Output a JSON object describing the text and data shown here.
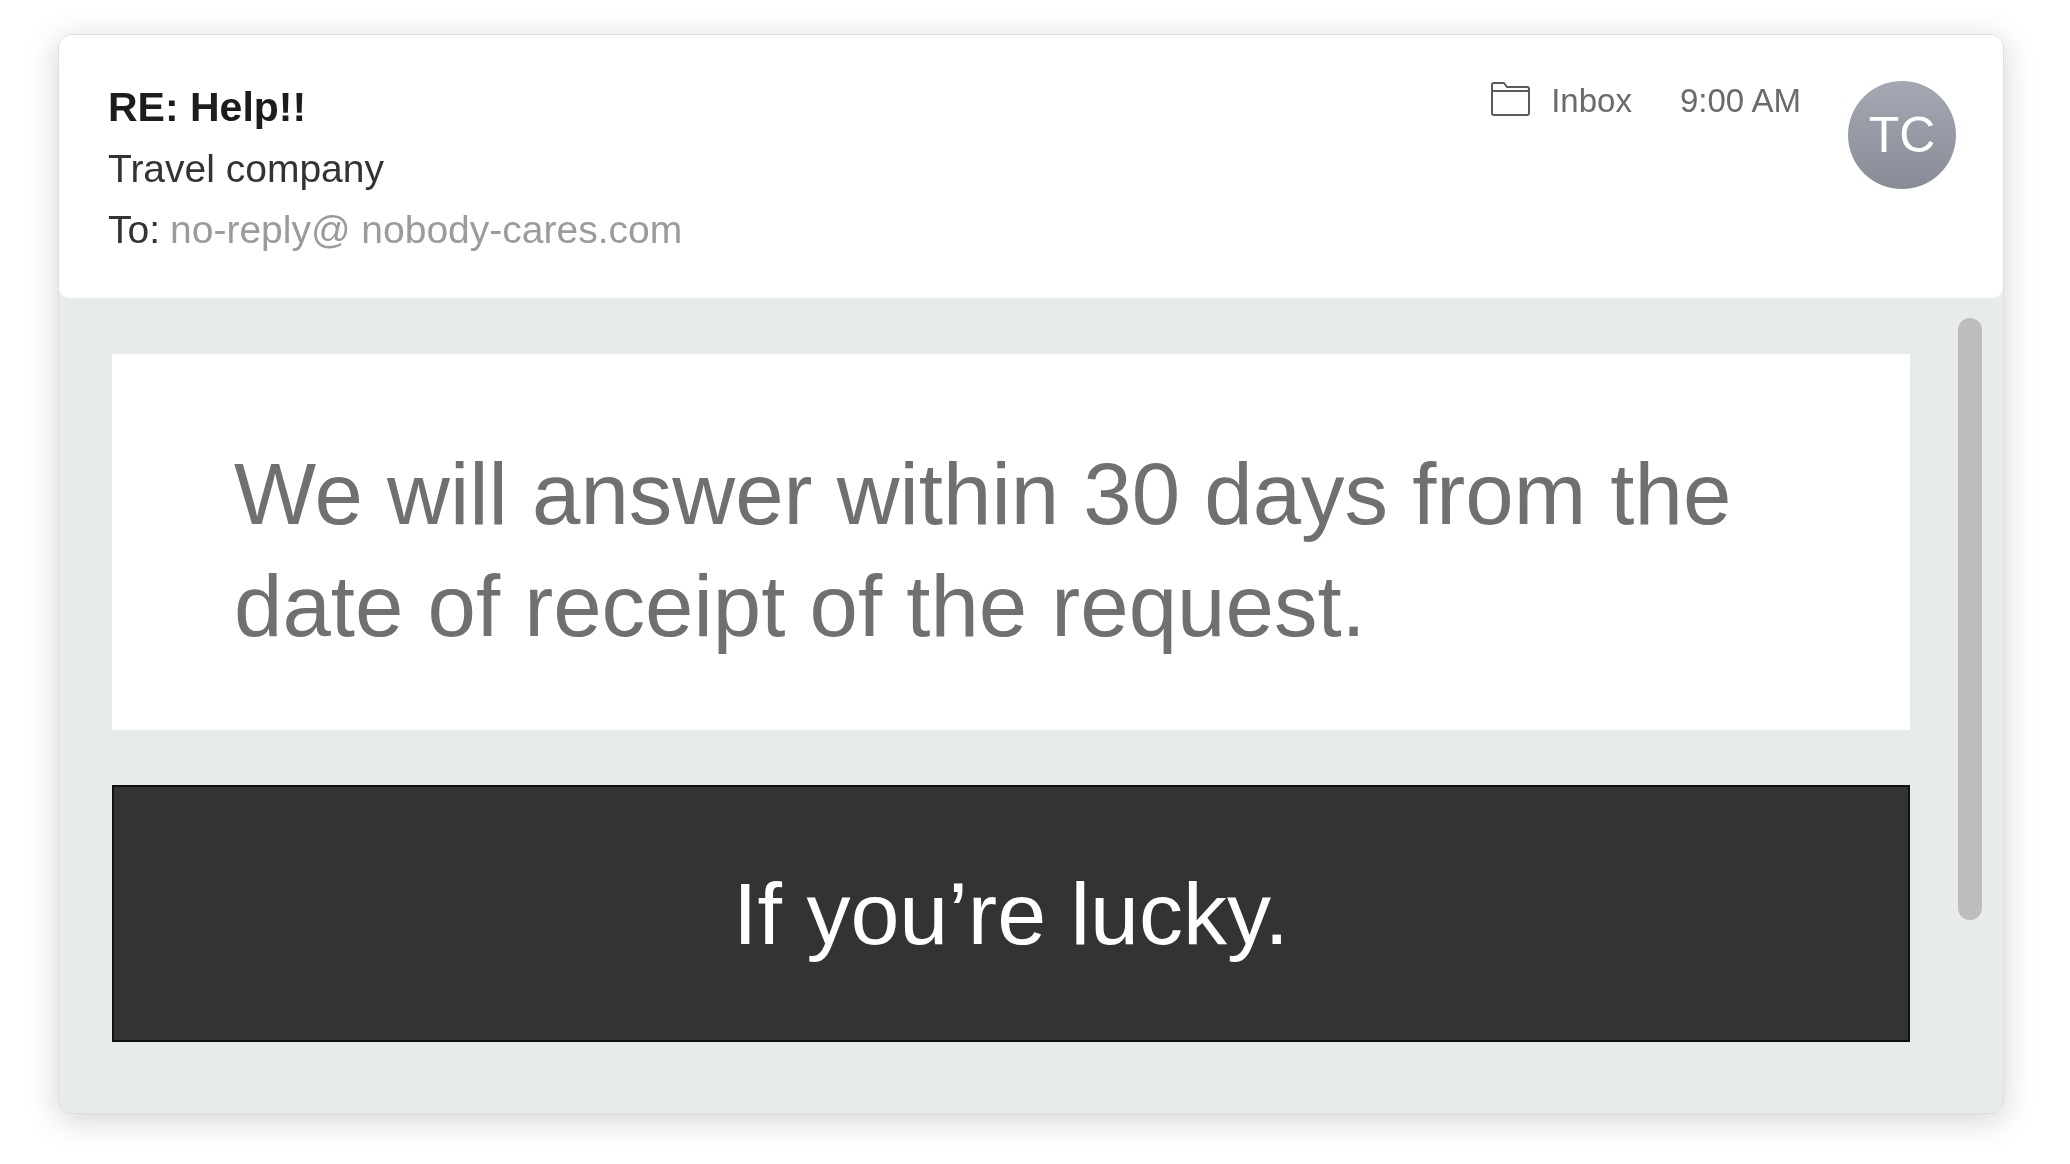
{
  "message": {
    "subject": "RE: Help!!",
    "sender": "Travel company",
    "recipient_label": "To:",
    "recipient": "no-reply@ nobody-cares.com",
    "folder": "Inbox",
    "time": "9:00 AM",
    "avatar_initials": "TC"
  },
  "body": {
    "blocks": [
      {
        "kind": "light",
        "text": "We will answer within 30 days from the date of receipt of the request."
      },
      {
        "kind": "dark",
        "text": "If you’re lucky."
      }
    ]
  }
}
